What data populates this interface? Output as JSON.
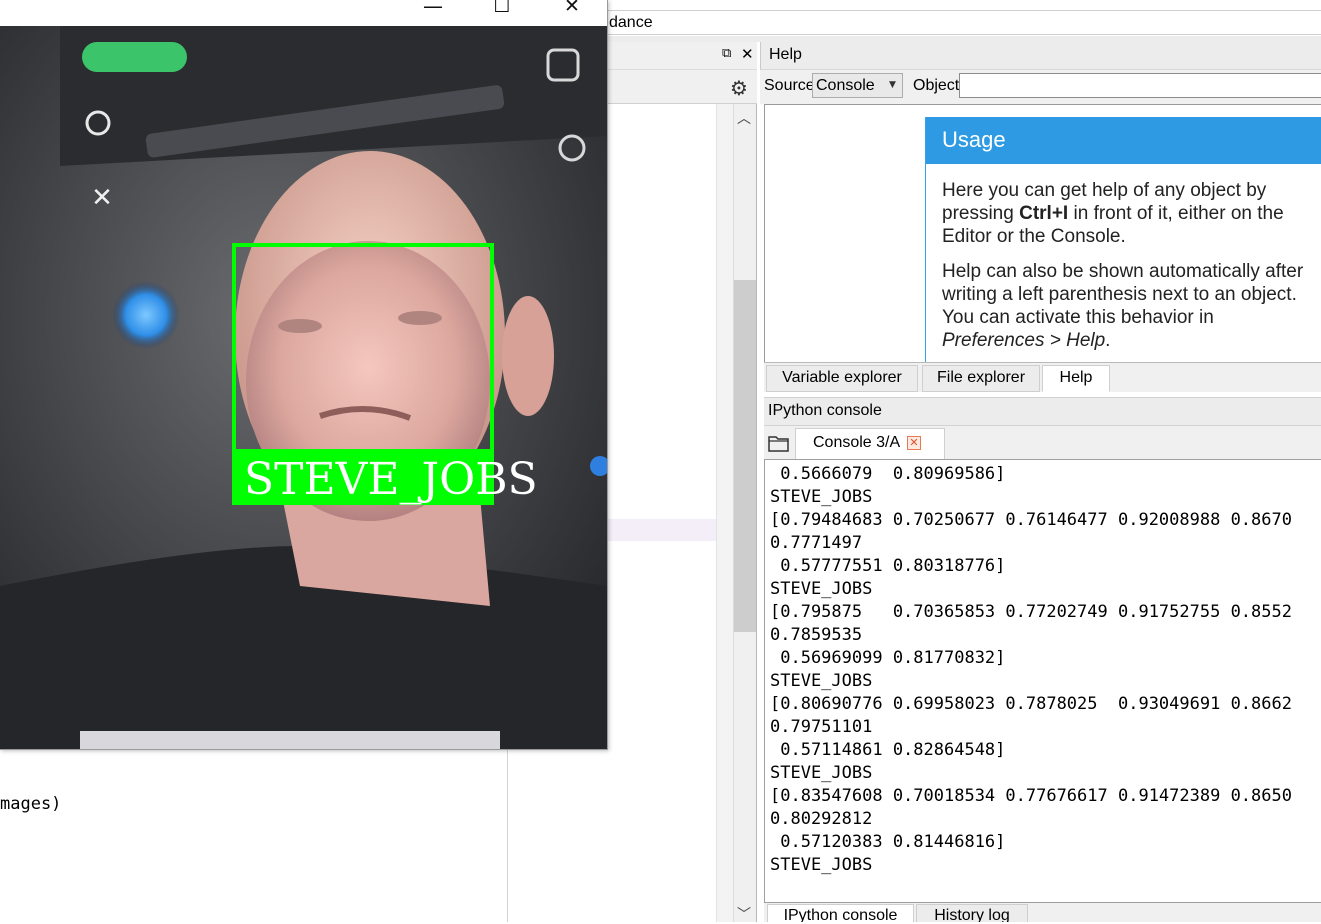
{
  "title_fragment": "dance",
  "editor": {
    "visible_line": "mages)"
  },
  "help_pane": {
    "title": "Help",
    "source_label": "Source",
    "source_value": "Console",
    "object_label": "Object",
    "object_value": "",
    "usage_title": "Usage",
    "p1_a": "Here you can get help of any object by pressing ",
    "p1_b": "Ctrl+I",
    "p1_c": " in front of it, either on the Editor or the Console.",
    "p2_a": "Help can also be shown automatically after writing a left parenthesis next to an object. You can activate this behavior in ",
    "p2_b": "Preferences > Help",
    "p2_c": "."
  },
  "pane_tabs": [
    {
      "label": "Variable explorer",
      "active": false
    },
    {
      "label": "File explorer",
      "active": false
    },
    {
      "label": "Help",
      "active": true
    }
  ],
  "ipython": {
    "title": "IPython console",
    "tab_label": "Console 3/A",
    "lines": [
      " 0.5666079  0.80969586]",
      "STEVE_JOBS",
      "[0.79484683 0.70250677 0.76146477 0.92008988 0.8670",
      "0.7771497",
      " 0.57777551 0.80318776]",
      "STEVE_JOBS",
      "[0.795875   0.70365853 0.77202749 0.91752755 0.8552",
      "0.7859535",
      " 0.56969099 0.81770832]",
      "STEVE_JOBS",
      "[0.80690776 0.69958023 0.7878025  0.93049691 0.8662",
      "0.79751101",
      " 0.57114861 0.82864548]",
      "STEVE_JOBS",
      "[0.83547608 0.70018534 0.77676617 0.91472389 0.8650",
      "0.80292812",
      " 0.57120383 0.81446816]",
      "STEVE_JOBS"
    ]
  },
  "bottom_tabs": [
    {
      "label": "IPython console",
      "active": true
    },
    {
      "label": "History log",
      "active": false
    }
  ],
  "camera_window": {
    "detected_label": "STEVE_JOBS",
    "box_color": "#00ff00",
    "window_controls": {
      "minimize": "—",
      "maximize": "☐",
      "close": "✕"
    }
  },
  "colors": {
    "usage_header": "#2d9ae3",
    "close_badge": "#e0502d"
  }
}
